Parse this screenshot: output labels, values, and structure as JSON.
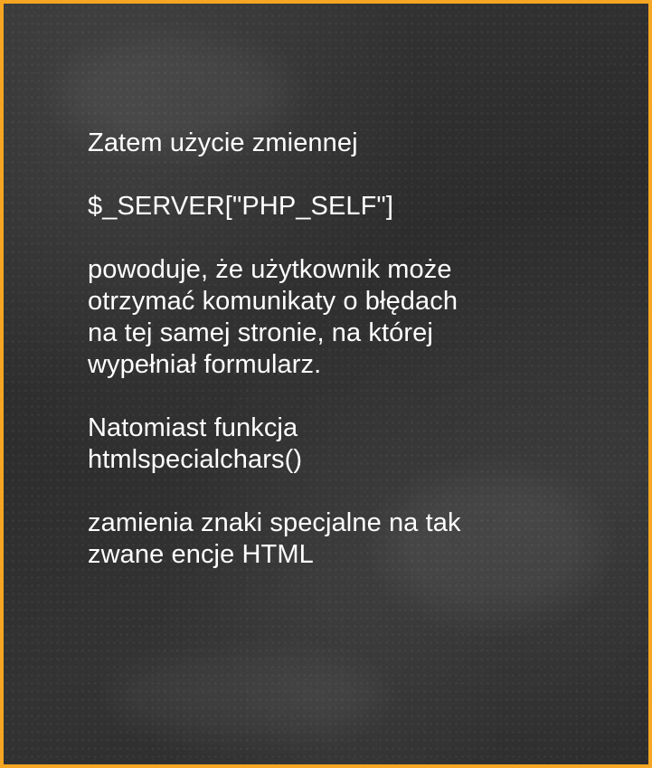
{
  "slide": {
    "border_color": "#f5a623",
    "background_color": "#2f2f2f",
    "text_color": "#ffffff",
    "paragraphs": [
      {
        "lines": [
          "Zatem użycie zmiennej"
        ]
      },
      {
        "lines": [
          "$_SERVER[\"PHP_SELF\"]"
        ]
      },
      {
        "lines": [
          "powoduje, że użytkownik może",
          "otrzymać komunikaty o błędach",
          "na tej samej stronie, na której",
          "wypełniał formularz."
        ]
      },
      {
        "lines": [
          "Natomiast funkcja",
          "htmlspecialchars()"
        ]
      },
      {
        "lines": [
          "zamienia znaki specjalne na tak",
          "zwane encje HTML"
        ]
      }
    ]
  }
}
